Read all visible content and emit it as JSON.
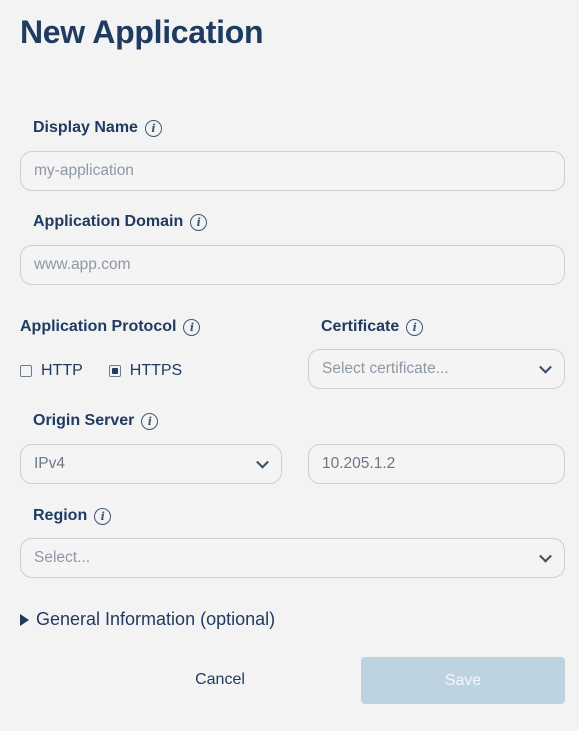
{
  "page": {
    "title": "New Application"
  },
  "display_name": {
    "label": "Display Name",
    "placeholder": "my-application"
  },
  "application_domain": {
    "label": "Application Domain",
    "placeholder": "www.app.com"
  },
  "application_protocol": {
    "label": "Application Protocol",
    "options": [
      {
        "label": "HTTP",
        "checked": false
      },
      {
        "label": "HTTPS",
        "checked": true
      }
    ]
  },
  "certificate": {
    "label": "Certificate",
    "placeholder": "Select certificate..."
  },
  "origin_server": {
    "label": "Origin Server",
    "ip_version": "IPv4",
    "address": "10.205.1.2"
  },
  "region": {
    "label": "Region",
    "placeholder": "Select..."
  },
  "general_information": {
    "label": "General Information (optional)"
  },
  "actions": {
    "cancel": "Cancel",
    "save": "Save"
  },
  "colors": {
    "heading": "#1f3b60",
    "save_disabled": "#bed3e0",
    "background": "#f3f3f4"
  }
}
